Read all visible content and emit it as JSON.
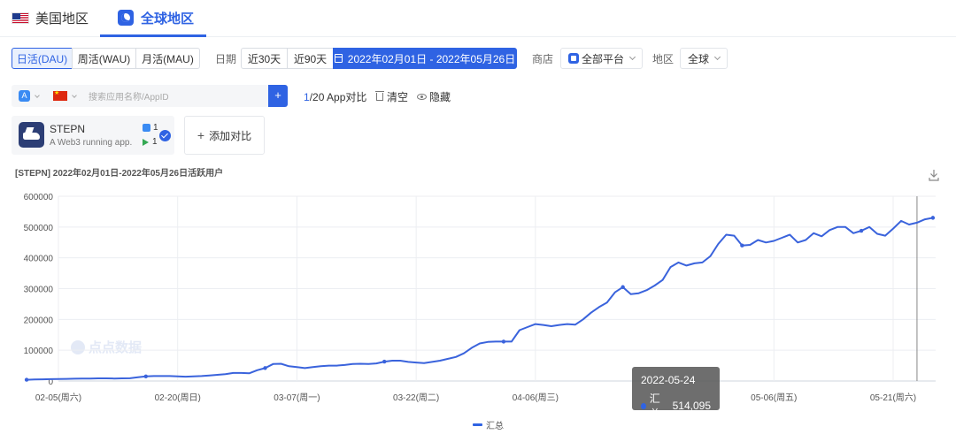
{
  "region_tabs": [
    {
      "label": "美国地区",
      "active": false
    },
    {
      "label": "全球地区",
      "active": true
    }
  ],
  "metric_segments": [
    "日活(DAU)",
    "周活(WAU)",
    "月活(MAU)"
  ],
  "date_filter": {
    "label": "日期",
    "options": [
      "近30天",
      "近90天"
    ],
    "range": "2022年02月01日 - 2022年05月26日"
  },
  "store_filter": {
    "label": "商店",
    "value": "全部平台"
  },
  "region_filter": {
    "label": "地区",
    "value": "全球"
  },
  "search": {
    "placeholder": "搜索应用名称/AppID",
    "add": "+"
  },
  "compare": {
    "count": "1",
    "suffix": "/20 App对比",
    "clear": "清空",
    "hide": "隐藏"
  },
  "app": {
    "name": "STEPN",
    "desc": "A Web3 running app.",
    "ios_rank": "1",
    "gp_rank": "1"
  },
  "add_compare": "添加对比",
  "watermark": "点点数据",
  "colors": {
    "accent": "#2f63e3",
    "line": "#3a63dc"
  },
  "chart_data": {
    "type": "line",
    "title": "[STEPN]  2022年02月01日-2022年05月26日活跃用户",
    "ylim": [
      0,
      600000
    ],
    "y_ticks": [
      0,
      100000,
      200000,
      300000,
      400000,
      500000,
      600000
    ],
    "x_ticks": [
      {
        "date": "2022-02-05",
        "label": "02-05(周六)"
      },
      {
        "date": "2022-02-20",
        "label": "02-20(周日)"
      },
      {
        "date": "2022-03-07",
        "label": "03-07(周一)"
      },
      {
        "date": "2022-03-22",
        "label": "03-22(周二)"
      },
      {
        "date": "2022-04-06",
        "label": "04-06(周三)"
      },
      {
        "date": "2022-05-06",
        "label": "05-06(周五)"
      },
      {
        "date": "2022-05-21",
        "label": "05-21(周六)"
      }
    ],
    "grid": true,
    "legend_position": "bottom",
    "series": [
      {
        "name": "汇总",
        "points": [
          [
            "2022-02-01",
            4000
          ],
          [
            "2022-02-02",
            5000
          ],
          [
            "2022-02-03",
            5500
          ],
          [
            "2022-02-04",
            6000
          ],
          [
            "2022-02-05",
            6500
          ],
          [
            "2022-02-06",
            7000
          ],
          [
            "2022-02-07",
            7500
          ],
          [
            "2022-02-08",
            8000
          ],
          [
            "2022-02-09",
            8000
          ],
          [
            "2022-02-10",
            8500
          ],
          [
            "2022-02-11",
            8500
          ],
          [
            "2022-02-12",
            8000
          ],
          [
            "2022-02-13",
            8500
          ],
          [
            "2022-02-14",
            9000
          ],
          [
            "2022-02-15",
            12000
          ],
          [
            "2022-02-16",
            15000
          ],
          [
            "2022-02-17",
            16000
          ],
          [
            "2022-02-18",
            16000
          ],
          [
            "2022-02-19",
            16000
          ],
          [
            "2022-02-20",
            15000
          ],
          [
            "2022-02-21",
            14000
          ],
          [
            "2022-02-22",
            15000
          ],
          [
            "2022-02-23",
            16000
          ],
          [
            "2022-02-24",
            18000
          ],
          [
            "2022-02-25",
            20000
          ],
          [
            "2022-02-26",
            22000
          ],
          [
            "2022-02-27",
            26000
          ],
          [
            "2022-02-28",
            26000
          ],
          [
            "2022-03-01",
            25000
          ],
          [
            "2022-03-02",
            35000
          ],
          [
            "2022-03-03",
            42000
          ],
          [
            "2022-03-04",
            55000
          ],
          [
            "2022-03-05",
            56000
          ],
          [
            "2022-03-06",
            48000
          ],
          [
            "2022-03-07",
            45000
          ],
          [
            "2022-03-08",
            42000
          ],
          [
            "2022-03-09",
            45000
          ],
          [
            "2022-03-10",
            48000
          ],
          [
            "2022-03-11",
            50000
          ],
          [
            "2022-03-12",
            50000
          ],
          [
            "2022-03-13",
            52000
          ],
          [
            "2022-03-14",
            55000
          ],
          [
            "2022-03-15",
            56000
          ],
          [
            "2022-03-16",
            55000
          ],
          [
            "2022-03-17",
            57000
          ],
          [
            "2022-03-18",
            63000
          ],
          [
            "2022-03-19",
            66000
          ],
          [
            "2022-03-20",
            66000
          ],
          [
            "2022-03-21",
            62000
          ],
          [
            "2022-03-22",
            60000
          ],
          [
            "2022-03-23",
            58000
          ],
          [
            "2022-03-24",
            62000
          ],
          [
            "2022-03-25",
            66000
          ],
          [
            "2022-03-26",
            72000
          ],
          [
            "2022-03-27",
            78000
          ],
          [
            "2022-03-28",
            90000
          ],
          [
            "2022-03-29",
            108000
          ],
          [
            "2022-03-30",
            122000
          ],
          [
            "2022-03-31",
            127000
          ],
          [
            "2022-04-01",
            128000
          ],
          [
            "2022-04-02",
            128000
          ],
          [
            "2022-04-03",
            128000
          ],
          [
            "2022-04-04",
            165000
          ],
          [
            "2022-04-05",
            175000
          ],
          [
            "2022-04-06",
            185000
          ],
          [
            "2022-04-07",
            182000
          ],
          [
            "2022-04-08",
            178000
          ],
          [
            "2022-04-09",
            182000
          ],
          [
            "2022-04-10",
            185000
          ],
          [
            "2022-04-11",
            183000
          ],
          [
            "2022-04-12",
            200000
          ],
          [
            "2022-04-13",
            222000
          ],
          [
            "2022-04-14",
            240000
          ],
          [
            "2022-04-15",
            255000
          ],
          [
            "2022-04-16",
            288000
          ],
          [
            "2022-04-17",
            305000
          ],
          [
            "2022-04-18",
            282000
          ],
          [
            "2022-04-19",
            285000
          ],
          [
            "2022-04-20",
            295000
          ],
          [
            "2022-04-21",
            310000
          ],
          [
            "2022-04-22",
            328000
          ],
          [
            "2022-04-23",
            370000
          ],
          [
            "2022-04-24",
            385000
          ],
          [
            "2022-04-25",
            375000
          ],
          [
            "2022-04-26",
            382000
          ],
          [
            "2022-04-27",
            385000
          ],
          [
            "2022-04-28",
            405000
          ],
          [
            "2022-04-29",
            445000
          ],
          [
            "2022-04-30",
            475000
          ],
          [
            "2022-05-01",
            472000
          ],
          [
            "2022-05-02",
            440000
          ],
          [
            "2022-05-03",
            442000
          ],
          [
            "2022-05-04",
            458000
          ],
          [
            "2022-05-05",
            450000
          ],
          [
            "2022-05-06",
            455000
          ],
          [
            "2022-05-07",
            465000
          ],
          [
            "2022-05-08",
            475000
          ],
          [
            "2022-05-09",
            450000
          ],
          [
            "2022-05-10",
            458000
          ],
          [
            "2022-05-11",
            480000
          ],
          [
            "2022-05-12",
            470000
          ],
          [
            "2022-05-13",
            490000
          ],
          [
            "2022-05-14",
            500000
          ],
          [
            "2022-05-15",
            500000
          ],
          [
            "2022-05-16",
            480000
          ],
          [
            "2022-05-17",
            488000
          ],
          [
            "2022-05-18",
            500000
          ],
          [
            "2022-05-19",
            478000
          ],
          [
            "2022-05-20",
            472000
          ],
          [
            "2022-05-21",
            495000
          ],
          [
            "2022-05-22",
            520000
          ],
          [
            "2022-05-23",
            508000
          ],
          [
            "2022-05-24",
            514095
          ],
          [
            "2022-05-25",
            525000
          ],
          [
            "2022-05-26",
            530000
          ]
        ]
      }
    ],
    "tooltip": {
      "date": "2022-05-24",
      "series": "汇总",
      "value": "514,095"
    }
  }
}
